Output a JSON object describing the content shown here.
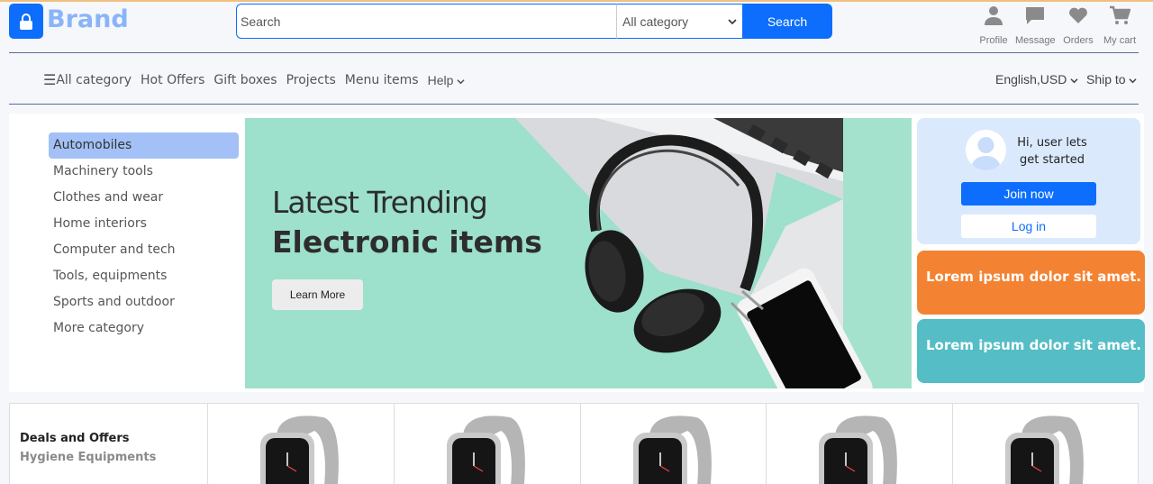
{
  "header": {
    "brand": "Brand",
    "search_placeholder": "Search",
    "category_select": "All category",
    "search_button": "Search",
    "icons": [
      {
        "label": "Profile",
        "icon": "person-icon"
      },
      {
        "label": "Message",
        "icon": "message-icon"
      },
      {
        "label": "Orders",
        "icon": "heart-icon"
      },
      {
        "label": "My cart",
        "icon": "cart-icon"
      }
    ]
  },
  "nav": {
    "items": [
      "All category",
      "Hot Offers",
      "Gift boxes",
      "Projects",
      "Menu items"
    ],
    "help": "Help",
    "language": "English,USD",
    "ship": "Ship to"
  },
  "categories": {
    "items": [
      "Automobiles",
      "Machinery tools",
      "Clothes and wear",
      "Home interiors",
      "Computer and tech",
      "Tools, equipments",
      "Sports and outdoor",
      "More category"
    ],
    "active_index": 0
  },
  "banner": {
    "line1": "Latest Trending",
    "line2": "Electronic items",
    "button": "Learn More"
  },
  "user_card": {
    "greeting_line1": "Hi, user lets",
    "greeting_line2": "get started",
    "join": "Join now",
    "login": "Log in"
  },
  "promos": [
    "Lorem ipsum dolor sit amet.",
    "Lorem ipsum dolor sit amet."
  ],
  "deals": {
    "title": "Deals and Offers",
    "subtitle": "Hygiene Equipments"
  },
  "colors": {
    "accent": "#0d6efd",
    "brand_text": "#8ab4f8",
    "banner_bg": "#9de0cb",
    "promo_orange": "#f38332",
    "promo_teal": "#55bdc5",
    "user_card_bg": "#dbe9fd"
  }
}
